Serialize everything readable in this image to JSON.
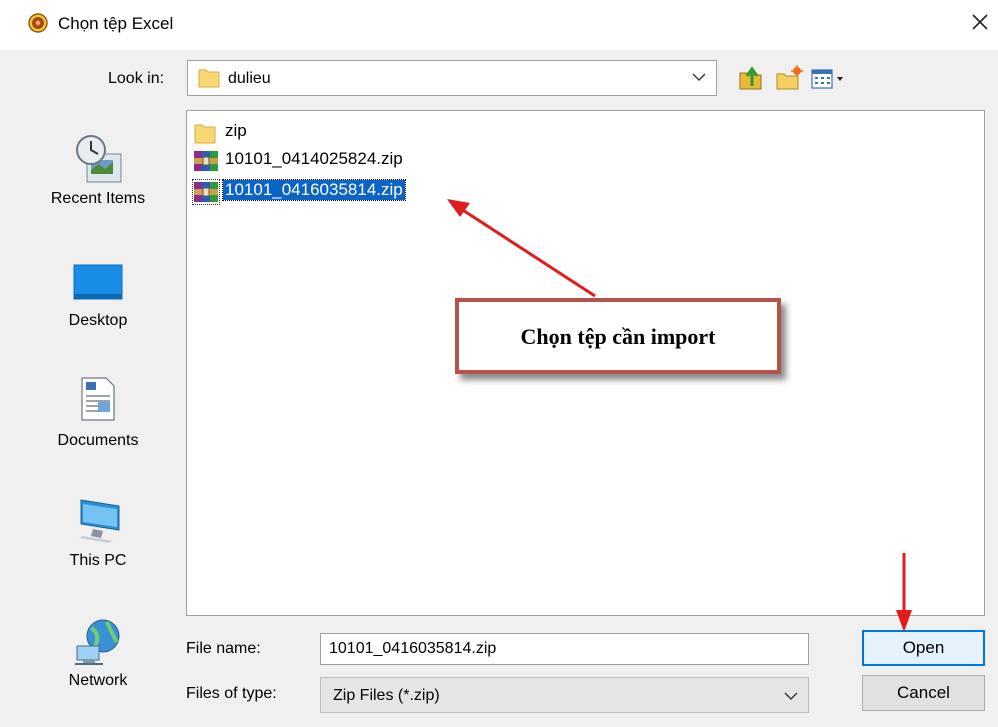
{
  "window": {
    "title": "Chọn tệp Excel"
  },
  "look_in": {
    "label": "Look in:",
    "value": "dulieu"
  },
  "toolbar": {
    "up_icon": "up-folder-icon",
    "new_folder_icon": "new-folder-icon",
    "view_menu_icon": "view-menu-icon"
  },
  "places": [
    {
      "label": "Recent Items",
      "icon": "recent-items-icon"
    },
    {
      "label": "Desktop",
      "icon": "desktop-icon"
    },
    {
      "label": "Documents",
      "icon": "documents-icon"
    },
    {
      "label": "This PC",
      "icon": "this-pc-icon"
    },
    {
      "label": "Network",
      "icon": "network-icon"
    }
  ],
  "files": [
    {
      "name": "zip",
      "type": "folder",
      "selected": false
    },
    {
      "name": "10101_0414025824.zip",
      "type": "archive",
      "selected": false
    },
    {
      "name": "10101_0416035814.zip",
      "type": "archive",
      "selected": true
    }
  ],
  "annotation": {
    "text": "Chọn tệp cần import",
    "color": "#b5544a",
    "arrow_color": "#e01c1c"
  },
  "file_name": {
    "label": "File name:",
    "value": "10101_0416035814.zip"
  },
  "file_type": {
    "label": "Files of type:",
    "value": "Zip Files (*.zip)"
  },
  "buttons": {
    "open": "Open",
    "cancel": "Cancel"
  },
  "colors": {
    "selection": "#0a64c8",
    "primary_border": "#0078d7"
  }
}
